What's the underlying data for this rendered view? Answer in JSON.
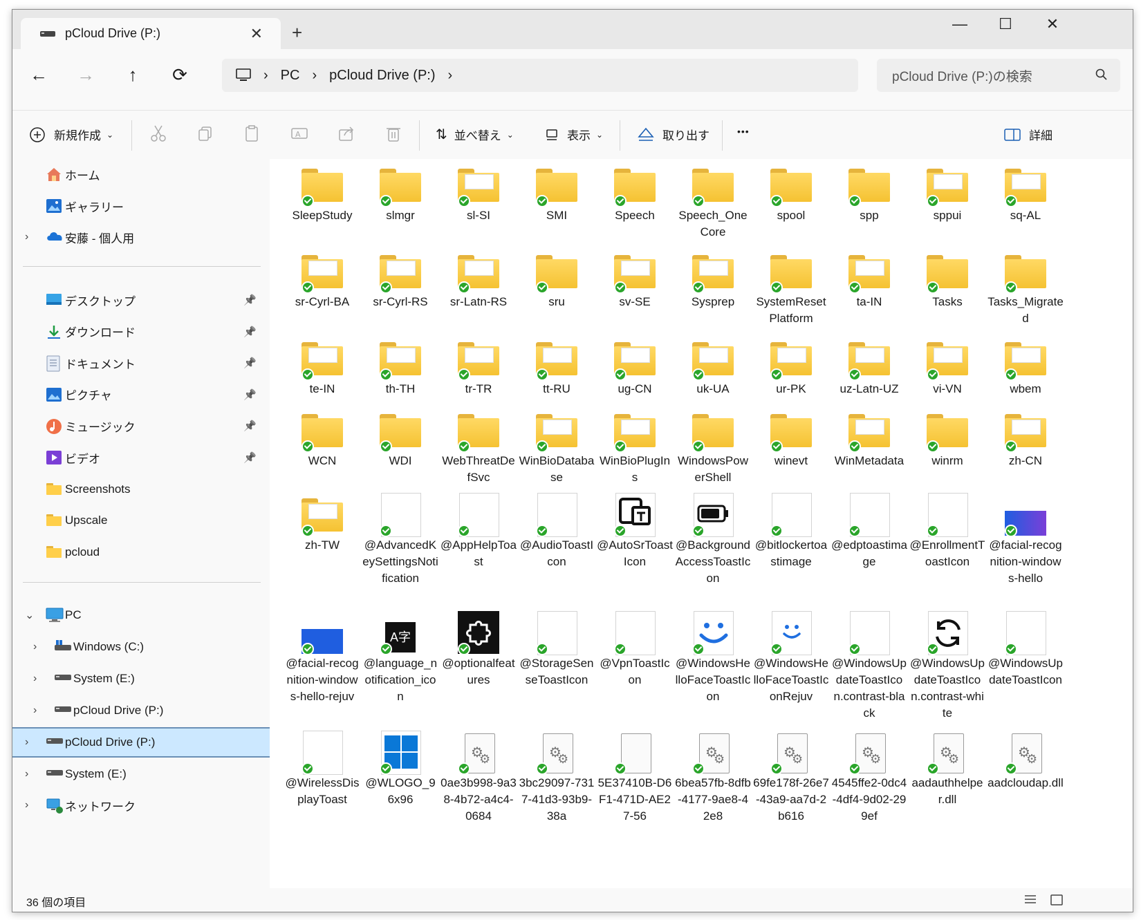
{
  "window": {
    "tab_title": "pCloud Drive (P:)",
    "close_tab": "✕",
    "new_tab": "+",
    "min": "—",
    "max": "☐",
    "close": "✕"
  },
  "nav": {
    "back": "←",
    "forward": "→",
    "up": "↑",
    "refresh": "⟳",
    "breadcrumb": [
      "PC",
      "pCloud Drive (P:)"
    ],
    "search_placeholder": "pCloud Drive (P:)の検索"
  },
  "toolbar": {
    "new_label": "新規作成",
    "sort_label": "並べ替え",
    "view_label": "表示",
    "eject_label": "取り出す",
    "more_label": "•••",
    "details_label": "詳細"
  },
  "sidebar": {
    "quick": [
      {
        "label": "ホーム",
        "icon": "home-icon"
      },
      {
        "label": "ギャラリー",
        "icon": "gallery-icon"
      },
      {
        "label": "安藤 - 個人用",
        "icon": "onedrive-icon"
      }
    ],
    "pinned": [
      {
        "label": "デスクトップ",
        "icon": "desktop-icon",
        "pinned": true
      },
      {
        "label": "ダウンロード",
        "icon": "download-icon",
        "pinned": true
      },
      {
        "label": "ドキュメント",
        "icon": "documents-icon",
        "pinned": true
      },
      {
        "label": "ピクチャ",
        "icon": "pictures-icon",
        "pinned": true
      },
      {
        "label": "ミュージック",
        "icon": "music-icon",
        "pinned": true
      },
      {
        "label": "ビデオ",
        "icon": "video-icon",
        "pinned": true
      },
      {
        "label": "Screenshots",
        "icon": "folder-icon",
        "pinned": false
      },
      {
        "label": "Upscale",
        "icon": "folder-icon",
        "pinned": false
      },
      {
        "label": "pcloud",
        "icon": "folder-icon",
        "pinned": false
      }
    ],
    "tree": [
      {
        "label": "PC",
        "icon": "pc-icon"
      },
      {
        "label": "Windows (C:)",
        "icon": "windows-drive-icon"
      },
      {
        "label": "System (E:)",
        "icon": "drive-icon"
      },
      {
        "label": "pCloud Drive (P:)",
        "icon": "drive-icon"
      },
      {
        "label": "pCloud Drive (P:)",
        "icon": "drive-icon"
      },
      {
        "label": "System (E:)",
        "icon": "drive-icon"
      },
      {
        "label": "ネットワーク",
        "icon": "network-icon"
      }
    ]
  },
  "items": [
    {
      "label": "SleepStudy",
      "type": "folder"
    },
    {
      "label": "slmgr",
      "type": "folder"
    },
    {
      "label": "sl-SI",
      "type": "folder-doc"
    },
    {
      "label": "SMI",
      "type": "folder"
    },
    {
      "label": "Speech",
      "type": "folder"
    },
    {
      "label": "Speech_OneCore",
      "type": "folder"
    },
    {
      "label": "spool",
      "type": "folder"
    },
    {
      "label": "spp",
      "type": "folder"
    },
    {
      "label": "sppui",
      "type": "folder-doc"
    },
    {
      "label": "sq-AL",
      "type": "folder-doc"
    },
    {
      "label": "sr-Cyrl-BA",
      "type": "folder-doc"
    },
    {
      "label": "sr-Cyrl-RS",
      "type": "folder-doc"
    },
    {
      "label": "sr-Latn-RS",
      "type": "folder-doc"
    },
    {
      "label": "sru",
      "type": "folder"
    },
    {
      "label": "sv-SE",
      "type": "folder-doc"
    },
    {
      "label": "Sysprep",
      "type": "folder-doc"
    },
    {
      "label": "SystemResetPlatform",
      "type": "folder"
    },
    {
      "label": "ta-IN",
      "type": "folder-doc"
    },
    {
      "label": "Tasks",
      "type": "folder"
    },
    {
      "label": "Tasks_Migrated",
      "type": "folder"
    },
    {
      "label": "te-IN",
      "type": "folder-doc"
    },
    {
      "label": "th-TH",
      "type": "folder-doc"
    },
    {
      "label": "tr-TR",
      "type": "folder-doc"
    },
    {
      "label": "tt-RU",
      "type": "folder-doc"
    },
    {
      "label": "ug-CN",
      "type": "folder-doc"
    },
    {
      "label": "uk-UA",
      "type": "folder-doc"
    },
    {
      "label": "ur-PK",
      "type": "folder-doc"
    },
    {
      "label": "uz-Latn-UZ",
      "type": "folder-doc"
    },
    {
      "label": "vi-VN",
      "type": "folder-doc"
    },
    {
      "label": "wbem",
      "type": "folder-doc"
    },
    {
      "label": "WCN",
      "type": "folder"
    },
    {
      "label": "WDI",
      "type": "folder"
    },
    {
      "label": "WebThreatDefSvc",
      "type": "folder"
    },
    {
      "label": "WinBioDatabase",
      "type": "folder-doc"
    },
    {
      "label": "WinBioPlugIns",
      "type": "folder-doc"
    },
    {
      "label": "WindowsPowerShell",
      "type": "folder"
    },
    {
      "label": "winevt",
      "type": "folder"
    },
    {
      "label": "WinMetadata",
      "type": "folder-doc"
    },
    {
      "label": "winrm",
      "type": "folder"
    },
    {
      "label": "zh-CN",
      "type": "folder-doc"
    },
    {
      "label": "zh-TW",
      "type": "folder-doc"
    },
    {
      "label": "@AdvancedKeySettingsNotification",
      "type": "image-white"
    },
    {
      "label": "@AppHelpToast",
      "type": "image-white"
    },
    {
      "label": "@AudioToastIcon",
      "type": "image-white"
    },
    {
      "label": "@AutoSrToastIcon",
      "type": "image-autosr"
    },
    {
      "label": "@BackgroundAccessToastIcon",
      "type": "image-battery"
    },
    {
      "label": "@bitlockertoastimage",
      "type": "image-white"
    },
    {
      "label": "@edptoastimage",
      "type": "image-white"
    },
    {
      "label": "@EnrollmentToastIcon",
      "type": "image-white"
    },
    {
      "label": "@facial-recognition-windows-hello",
      "type": "image-gradient"
    },
    {
      "label": "@facial-recognition-windows-hello-rejuv",
      "type": "image-blue"
    },
    {
      "label": "@language_notification_icon",
      "type": "image-lang"
    },
    {
      "label": "@optionalfeatures",
      "type": "image-puzzle"
    },
    {
      "label": "@StorageSenseToastIcon",
      "type": "image-white"
    },
    {
      "label": "@VpnToastIcon",
      "type": "image-white"
    },
    {
      "label": "@WindowsHelloFaceToastIcon",
      "type": "image-smile"
    },
    {
      "label": "@WindowsHelloFaceToastIconRejuv",
      "type": "image-smile-small"
    },
    {
      "label": "@WindowsUpdateToastIcon.contrast-black",
      "type": "image-white"
    },
    {
      "label": "@WindowsUpdateToastIcon.contrast-white",
      "type": "image-sync"
    },
    {
      "label": "@WindowsUpdateToastIcon",
      "type": "image-white"
    },
    {
      "label": "@WirelessDisplayToast",
      "type": "image-white"
    },
    {
      "label": "@WLOGO_96x96",
      "type": "image-winlogo"
    },
    {
      "label": "0ae3b998-9a38-4b72-a4c4-0684",
      "type": "dll"
    },
    {
      "label": "3bc29097-7317-41d3-93b9-38a",
      "type": "dll"
    },
    {
      "label": "5E37410B-D6F1-471D-AE27-56",
      "type": "blank-doc"
    },
    {
      "label": "6bea57fb-8dfb-4177-9ae8-42e8",
      "type": "dll"
    },
    {
      "label": "69fe178f-26e7-43a9-aa7d-2b616",
      "type": "dll"
    },
    {
      "label": "4545ffe2-0dc4-4df4-9d02-299ef",
      "type": "dll"
    },
    {
      "label": "aadauthhelper.dll",
      "type": "dll"
    },
    {
      "label": "aadcloudap.dll",
      "type": "dll"
    }
  ],
  "status": {
    "count": "36 個の項目"
  }
}
